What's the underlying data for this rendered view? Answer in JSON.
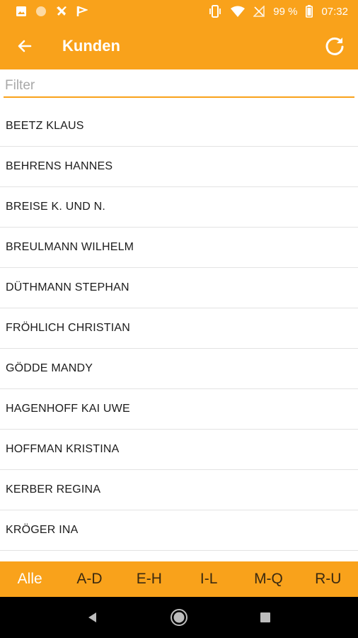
{
  "status_bar": {
    "battery_text": "99 %",
    "time": "07:32"
  },
  "app_bar": {
    "title": "Kunden"
  },
  "filter": {
    "placeholder": "Filter",
    "value": ""
  },
  "customers": [
    "BEETZ KLAUS",
    "BEHRENS HANNES",
    "BREISE K. UND N.",
    "BREULMANN WILHELM",
    "DÜTHMANN STEPHAN",
    "FRÖHLICH CHRISTIAN",
    "GÖDDE MANDY",
    "HAGENHOFF KAI UWE",
    "HOFFMAN KRISTINA",
    "KERBER REGINA",
    "KRÖGER INA"
  ],
  "letter_tabs": [
    "Alle",
    "A-D",
    "E-H",
    "I-L",
    "M-Q",
    "R-U"
  ],
  "active_tab": "Alle",
  "colors": {
    "accent": "#f9a21b",
    "tab_text": "#3b2a10",
    "active_tab_text": "#ffffff"
  }
}
